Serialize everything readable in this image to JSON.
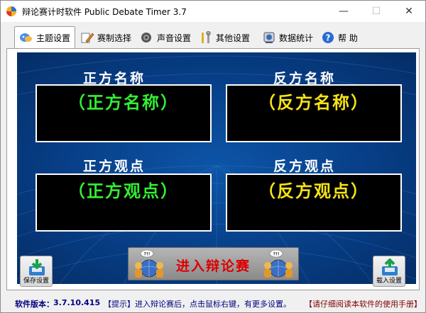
{
  "window": {
    "title": "辩论赛计时软件 Public Debate Timer 3.7",
    "minimize_glyph": "—",
    "maximize_glyph": "☐",
    "close_glyph": "✕"
  },
  "tabs": [
    {
      "label": "主题设置",
      "icon": "theme-icon",
      "active": true
    },
    {
      "label": "赛制选择",
      "icon": "pen-icon",
      "active": false
    },
    {
      "label": "声音设置",
      "icon": "speaker-icon",
      "active": false
    },
    {
      "label": "其他设置",
      "icon": "tools-icon",
      "active": false
    },
    {
      "label": "数据统计",
      "icon": "database-icon",
      "active": false
    },
    {
      "label": "帮 助",
      "icon": "help-icon",
      "active": false
    }
  ],
  "board": {
    "pro_name_label": "正方名称",
    "con_name_label": "反方名称",
    "pro_name_value": "（正方名称）",
    "con_name_value": "（反方名称）",
    "pro_view_label": "正方观点",
    "con_view_label": "反方观点",
    "pro_view_value": "（正方观点）",
    "con_view_value": "（反方观点）"
  },
  "buttons": {
    "save_label": "保存设置",
    "load_label": "载入设置",
    "enter_label": "进入辩论赛"
  },
  "status": {
    "version_label": "软件版本：",
    "version": "3.7.10.415",
    "tip": "【提示】进入辩论赛后，点击鼠标右键，有更多设置。",
    "manual": "【请仔细阅读本软件的使用手册】"
  },
  "colors": {
    "board_blue": "#073e86",
    "pro_text": "#33ee33",
    "con_text": "#f7e315",
    "enter_text": "#dd0000",
    "status_blue": "#000080"
  }
}
